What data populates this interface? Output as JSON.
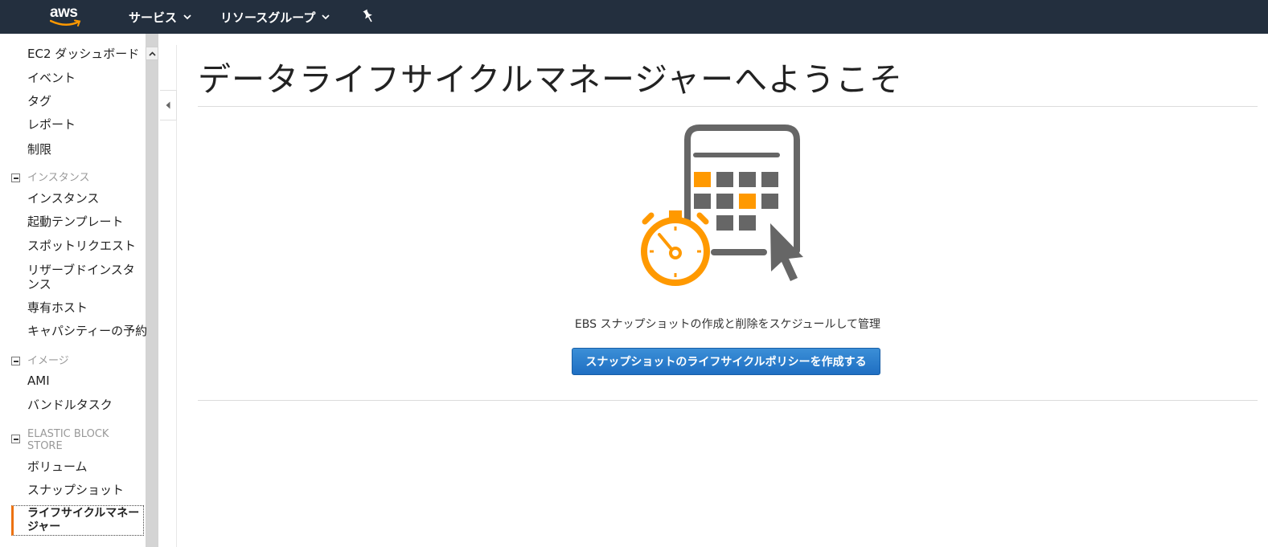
{
  "topbar": {
    "logo_text": "aws",
    "services_label": "サービス",
    "resource_groups_label": "リソースグループ"
  },
  "sidebar": {
    "items_top": [
      "EC2 ダッシュボード",
      "イベント",
      "タグ",
      "レポート",
      "制限"
    ],
    "section_instances": "インスタンス",
    "instances_items": [
      "インスタンス",
      "起動テンプレート",
      "スポットリクエスト",
      "リザーブドインスタンス",
      "専有ホスト",
      "キャパシティーの予約"
    ],
    "section_images": "イメージ",
    "images_items": [
      "AMI",
      "バンドルタスク"
    ],
    "section_ebs": "ELASTIC BLOCK STORE",
    "ebs_items": [
      "ボリューム",
      "スナップショット",
      "ライフサイクルマネージャー"
    ],
    "active_item": "ライフサイクルマネージャー"
  },
  "main": {
    "title": "データライフサイクルマネージャーへようこそ",
    "description": "EBS スナップショットの作成と削除をスケジュールして管理",
    "create_button_label": "スナップショットのライフサイクルポリシーを作成する",
    "hero_icon": "calendar-stopwatch-icon"
  },
  "colors": {
    "topbar_bg": "#232f3e",
    "accent_orange": "#f90",
    "primary_button": "#1f6fc2",
    "icon_gray": "#666666"
  }
}
